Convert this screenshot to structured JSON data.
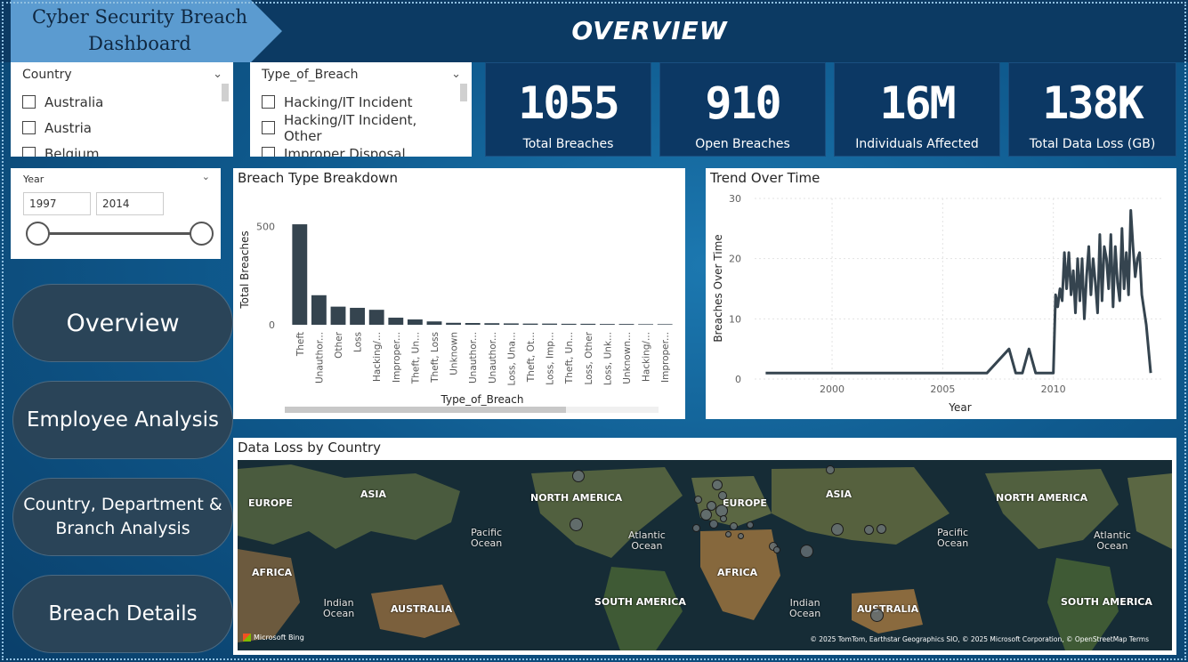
{
  "header": {
    "dashboard_title_line1": "Cyber Security Breach",
    "dashboard_title_line2": "Dashboard",
    "page_heading": "OVERVIEW"
  },
  "country_slicer": {
    "label": "Country",
    "items": [
      "Australia",
      "Austria",
      "Belgium"
    ]
  },
  "breach_type_slicer": {
    "label": "Type_of_Breach",
    "items": [
      "Hacking/IT Incident",
      "Hacking/IT Incident, Other",
      "Improper Disposal"
    ]
  },
  "kpis": [
    {
      "value": "1055",
      "label": "Total Breaches"
    },
    {
      "value": "910",
      "label": "Open Breaches"
    },
    {
      "value": "16M",
      "label": "Individuals Affected"
    },
    {
      "value": "138K",
      "label": "Total Data Loss (GB)"
    }
  ],
  "year_slicer": {
    "label": "Year",
    "from": "1997",
    "to": "2014",
    "range_fraction": [
      0,
      1
    ]
  },
  "nav": [
    {
      "label": "Overview"
    },
    {
      "label": "Employee Analysis"
    },
    {
      "label": "Country, Department &\nBranch Analysis"
    },
    {
      "label": "Breach Details"
    }
  ],
  "chart_data": [
    {
      "type": "bar",
      "title": "Breach Type Breakdown",
      "xlabel": "Type_of_Breach",
      "ylabel": "Total Breaches",
      "categories": [
        "Theft",
        "Unauthor...",
        "Other",
        "Loss",
        "Hacking/...",
        "Improper...",
        "Theft, Un...",
        "Theft, Loss",
        "Unknown",
        "Unauthor...",
        "Unauthor...",
        "Loss, Una...",
        "Theft, Ot...",
        "Loss, Imp...",
        "Theft, Un...",
        "Loss, Other",
        "Loss, Unk...",
        "Unknown...",
        "Hacking/...",
        "Improper..."
      ],
      "values": [
        510,
        150,
        92,
        86,
        76,
        36,
        27,
        17,
        10,
        9,
        8,
        7,
        6,
        6,
        5,
        5,
        4,
        4,
        3,
        3
      ],
      "yticks": [
        0,
        500
      ],
      "ylim": [
        0,
        560
      ],
      "grid": false
    },
    {
      "type": "line",
      "title": "Trend Over Time",
      "xlabel": "Year",
      "ylabel": "Breaches Over Time",
      "xticks": [
        2000,
        2005,
        2010
      ],
      "yticks": [
        0,
        10,
        20,
        30
      ],
      "xlim": [
        1996.5,
        2015
      ],
      "ylim": [
        0,
        30
      ],
      "grid": true,
      "x": [
        1997,
        2007,
        2008,
        2008.3,
        2008.6,
        2008.9,
        2009.2,
        2009.5,
        2009.8,
        2010,
        2010.1,
        2010.2,
        2010.3,
        2010.4,
        2010.5,
        2010.6,
        2010.7,
        2010.8,
        2010.9,
        2011,
        2011.1,
        2011.2,
        2011.3,
        2011.4,
        2011.5,
        2011.6,
        2011.7,
        2011.8,
        2011.9,
        2012,
        2012.1,
        2012.2,
        2012.3,
        2012.4,
        2012.5,
        2012.6,
        2012.7,
        2012.8,
        2012.9,
        2013,
        2013.1,
        2013.2,
        2013.3,
        2013.4,
        2013.5,
        2013.6,
        2013.7,
        2013.8,
        2013.9,
        2014,
        2014.2,
        2014.4
      ],
      "y": [
        1,
        1,
        5,
        1,
        1,
        5,
        1,
        1,
        1,
        1,
        14,
        12,
        15,
        13,
        21,
        15,
        21,
        14,
        18,
        11,
        20,
        13,
        20,
        10,
        17,
        22,
        14,
        20,
        16,
        11,
        24,
        13,
        22,
        20,
        15,
        24,
        12,
        22,
        16,
        13,
        25,
        15,
        21,
        14,
        28,
        22,
        17,
        20,
        21,
        14,
        9,
        1
      ]
    }
  ],
  "map": {
    "title": "Data Loss by Country",
    "labels": [
      {
        "text": "EUROPE",
        "kind": "continent"
      },
      {
        "text": "ASIA",
        "kind": "continent"
      },
      {
        "text": "NORTH AMERICA",
        "kind": "continent"
      },
      {
        "text": "EUROPE",
        "kind": "continent"
      },
      {
        "text": "ASIA",
        "kind": "continent"
      },
      {
        "text": "NORTH AMERICA",
        "kind": "continent"
      },
      {
        "text": "Pacific\nOcean",
        "kind": "ocean"
      },
      {
        "text": "Atlantic\nOcean",
        "kind": "ocean"
      },
      {
        "text": "Pacific\nOcean",
        "kind": "ocean"
      },
      {
        "text": "Atlantic\nOcean",
        "kind": "ocean"
      },
      {
        "text": "AFRICA",
        "kind": "continent"
      },
      {
        "text": "AFRICA",
        "kind": "continent"
      },
      {
        "text": "Indian\nOcean",
        "kind": "ocean"
      },
      {
        "text": "Indian\nOcean",
        "kind": "ocean"
      },
      {
        "text": "AUSTRALIA",
        "kind": "continent"
      },
      {
        "text": "SOUTH AMERICA",
        "kind": "continent"
      },
      {
        "text": "AUSTRALIA",
        "kind": "continent"
      },
      {
        "text": "SOUTH AMERICA",
        "kind": "continent"
      }
    ],
    "attribution": "Microsoft Bing",
    "copyright": "© 2025 TomTom, Earthstar Geographics SIO, © 2025 Microsoft Corporation, © OpenStreetMap  Terms"
  },
  "colors": {
    "accent": "#0c3864",
    "bar": "#35444f",
    "nav_button": "#2a4458",
    "title_banner": "#5b9bd0"
  }
}
